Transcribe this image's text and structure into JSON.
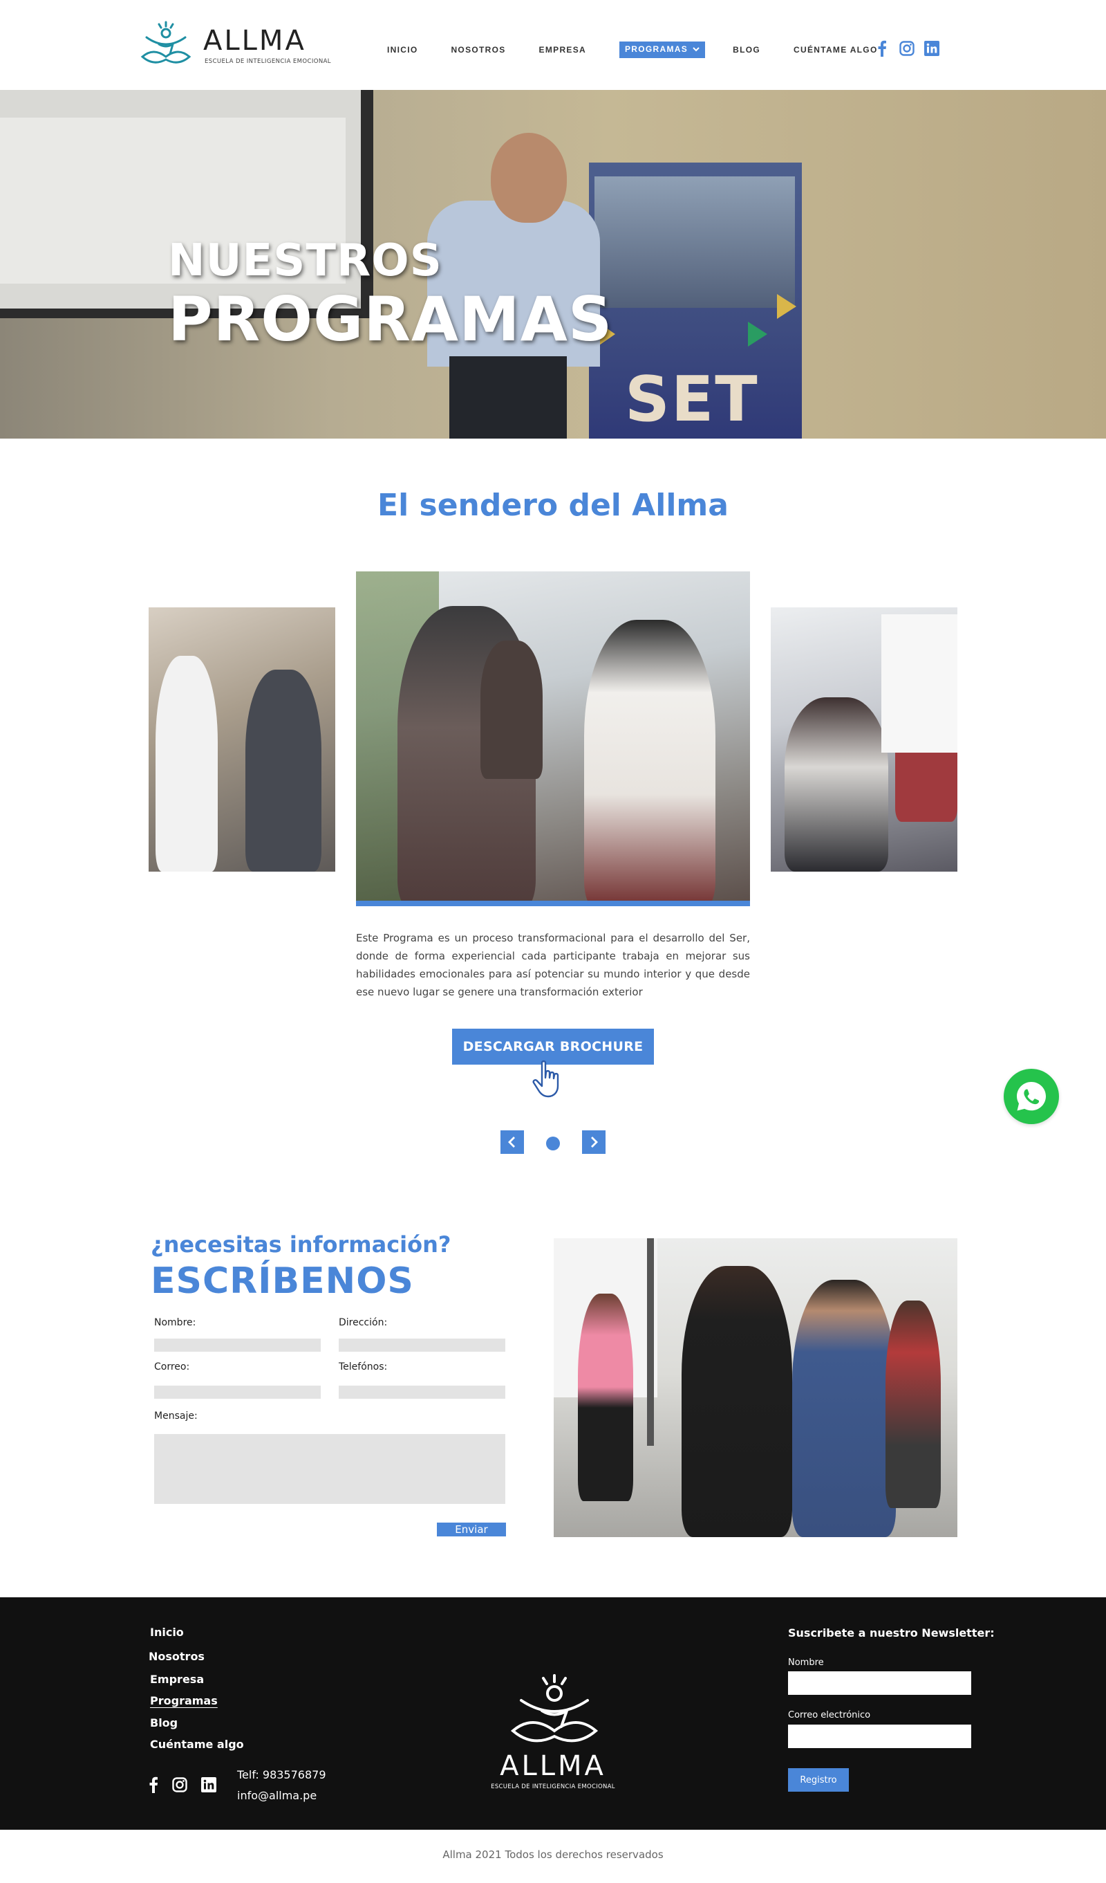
{
  "brand": {
    "name": "ALLMA",
    "tagline": "ESCUELA DE INTELIGENCIA EMOCIONAL",
    "accent_color": "#4a86d8",
    "logo_color": "#1f8fa3"
  },
  "nav": {
    "items": [
      {
        "label": "INICIO"
      },
      {
        "label": "NOSOTROS"
      },
      {
        "label": "EMPRESA"
      },
      {
        "label": "PROGRAMAS",
        "active": true,
        "icon": "chevron-down-icon"
      },
      {
        "label": "BLOG"
      },
      {
        "label": "CUÉNTAME ALGO"
      }
    ],
    "social": [
      "facebook-icon",
      "instagram-icon",
      "linkedin-icon"
    ]
  },
  "hero": {
    "title_line1": "NUESTROS",
    "title_line2": "PROGRAMAS",
    "banner_text": "SET"
  },
  "program": {
    "title": "El sendero del Allma",
    "description": "Este Programa es un proceso transformacional para el desarrollo del Ser, donde de forma experiencial cada participante trabaja en mejorar sus habilidades emocionales para así potenciar su mundo interior y que desde ese nuevo lugar se genere una transformación exterior",
    "button_label": "DESCARGAR BROCHURE",
    "button_icon": "hand-pointer-icon",
    "carousel_slide_count": 1,
    "carousel_active_slide": 1
  },
  "contact": {
    "subtitle": "¿necesitas información?",
    "title": "ESCRÍBENOS",
    "labels": {
      "name": "Nombre:",
      "address": "Dirección:",
      "email": "Correo:",
      "phones": "Telefónos:",
      "message": "Mensaje:"
    },
    "submit_label": "Enviar"
  },
  "whatsapp_icon": "whatsapp-icon",
  "footer": {
    "links": [
      "Inicio",
      "Nosotros",
      "Empresa",
      "Programas",
      "Blog",
      "Cuéntame algo"
    ],
    "phone": "Telf: 983576879",
    "email": "info@allma.pe",
    "newsletter": {
      "title": "Suscribete a nuestro Newsletter:",
      "name_label": "Nombre",
      "email_label": "Correo electrónico",
      "button_label": "Registro"
    }
  },
  "copyright": "Allma 2021 Todos los derechos reservados"
}
